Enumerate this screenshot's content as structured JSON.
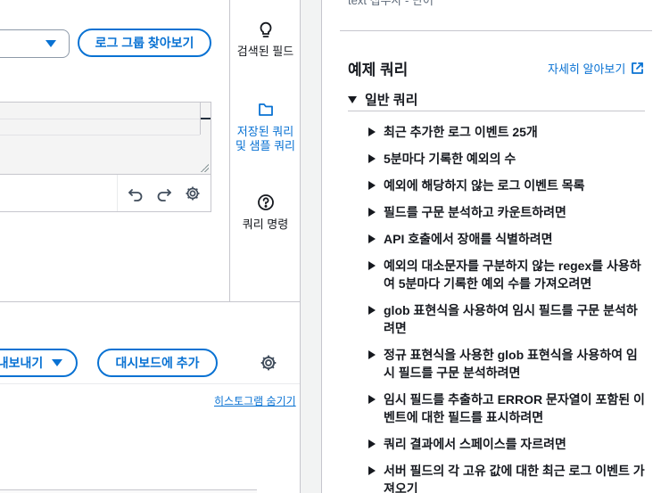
{
  "left": {
    "find_log_groups_label": "로그 그룹 찾아보기",
    "export_label": "내보내기",
    "add_to_dashboard_label": "대시보드에 추가",
    "hide_histogram_label": "히스토그램 숨기기"
  },
  "rail": {
    "discovered_fields_label": "검색된 필드",
    "saved_queries_label": "저장된 쿼리\n및 샘플 쿼리",
    "query_commands_label": "쿼리 명령"
  },
  "help": {
    "cut_text": "text 접두사 - 단어",
    "section_title": "예제 쿼리",
    "learn_more_label": "자세히 알아보기",
    "group_label": "일반 쿼리",
    "queries": [
      "최근 추가한 로그 이벤트 25개",
      "5분마다 기록한 예외의 수",
      "예외에 해당하지 않는 로그 이벤트 목록",
      "필드를 구문 분석하고 카운트하려면",
      "API 호출에서 장애를 식별하려면",
      "예외의 대소문자를 구분하지 않는 regex를 사용하여 5분마다 기록한 예외 수를 가져오려면",
      "glob 표현식을 사용하여 임시 필드를 구문 분석하려면",
      "정규 표현식을 사용한 glob 표현식을 사용하여 임시 필드를 구문 분석하려면",
      "임시 필드를 추출하고 ERROR 문자열이 포함된 이벤트에 대한 필드를 표시하려면",
      "쿼리 결과에서 스페이스를 자르려면",
      "서버 필드의 각 고유 값에 대한 최근 로그 이벤트 가져오기"
    ]
  },
  "colors": {
    "accent": "#0972d3",
    "border": "#c6c6cd",
    "text": "#16191f"
  }
}
